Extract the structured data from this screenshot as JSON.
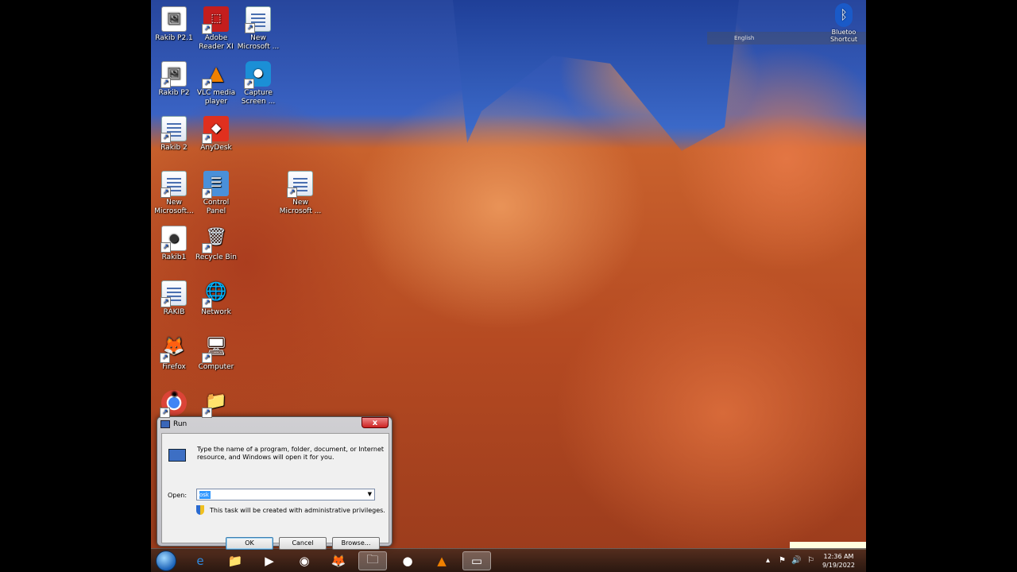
{
  "desktop": {
    "icons": [
      {
        "label": "Rakib P2.1",
        "glyph": "🖼",
        "kind": "image"
      },
      {
        "label": "Adobe Reader XI",
        "glyph": "⬚",
        "kind": "pdf"
      },
      {
        "label": "New Microsoft ...",
        "glyph": "",
        "kind": "doc"
      },
      {
        "label": "Rakib P2",
        "glyph": "🖼",
        "kind": "image"
      },
      {
        "label": "VLC media player",
        "glyph": "▲",
        "kind": "vlc"
      },
      {
        "label": "Capture Screen ...",
        "glyph": "●",
        "kind": "capture"
      },
      {
        "label": "Rakib 2",
        "glyph": "",
        "kind": "doc"
      },
      {
        "label": "AnyDesk",
        "glyph": "◆",
        "kind": "anydesk"
      },
      {
        "label": "New Microsoft...",
        "glyph": "",
        "kind": "excel"
      },
      {
        "label": "Control Panel",
        "glyph": "☰",
        "kind": "control"
      },
      {
        "label": "New Microsoft ...",
        "glyph": "",
        "kind": "doc"
      },
      {
        "label": "Rakib1",
        "glyph": "●",
        "kind": "image"
      },
      {
        "label": "Recycle Bin",
        "glyph": "🗑",
        "kind": "bin"
      },
      {
        "label": "RAKIB",
        "glyph": "",
        "kind": "doc"
      },
      {
        "label": "Network",
        "glyph": "🌐",
        "kind": "network"
      },
      {
        "label": "Firefox",
        "glyph": "🦊",
        "kind": "firefox"
      },
      {
        "label": "Computer",
        "glyph": "🖥",
        "kind": "computer"
      },
      {
        "label": "",
        "glyph": "◉",
        "kind": "chrome"
      },
      {
        "label": "",
        "glyph": "📁",
        "kind": "folder"
      }
    ],
    "bluetooth": {
      "label": "Bluetoo Shortcut",
      "glyph": "ᛒ"
    },
    "langbar": {
      "text": "English"
    }
  },
  "run_dialog": {
    "title": "Run",
    "close_glyph": "x",
    "description": "Type the name of a program, folder, document, or Internet resource, and Windows will open it for you.",
    "open_label": "Open:",
    "open_value": "osk",
    "combo_arrow": "▼",
    "admin_note": "This task will be created with administrative privileges.",
    "ok": "OK",
    "cancel": "Cancel",
    "browse": "Browse..."
  },
  "taskbar": {
    "clock_time": "12:36 AM",
    "clock_date": "9/19/2022",
    "apps": [
      {
        "name": "ie",
        "glyph": "e"
      },
      {
        "name": "explorer",
        "glyph": "📁"
      },
      {
        "name": "media",
        "glyph": "▶"
      },
      {
        "name": "chrome",
        "glyph": "◉"
      },
      {
        "name": "firefox",
        "glyph": "🦊"
      },
      {
        "name": "folder",
        "glyph": "🗀"
      },
      {
        "name": "capture",
        "glyph": "●"
      },
      {
        "name": "vlc",
        "glyph": "▲"
      },
      {
        "name": "run",
        "glyph": "▭"
      }
    ],
    "tray_glyphs": [
      "▴",
      "⚑",
      "🔊",
      "⚐"
    ]
  },
  "colors": {
    "accent": "#3399ff",
    "close": "#c22"
  }
}
